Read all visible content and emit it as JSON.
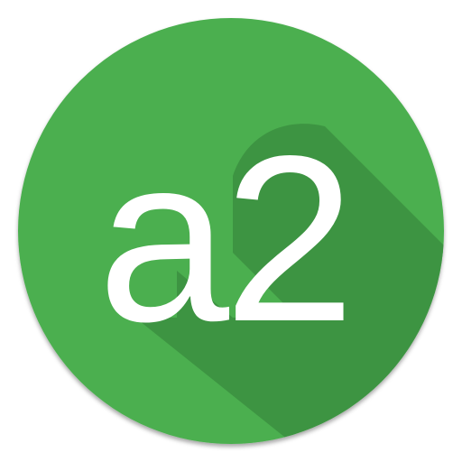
{
  "app_icon": {
    "logo_text": "a2",
    "colors": {
      "background": "#4caf50",
      "long_shadow": "#3b8f40",
      "glyph": "#ffffff",
      "rim_shadow": "#8a8a8a"
    },
    "icon_names": {
      "badge": "circle-badge-icon",
      "shadow": "long-shadow"
    }
  }
}
